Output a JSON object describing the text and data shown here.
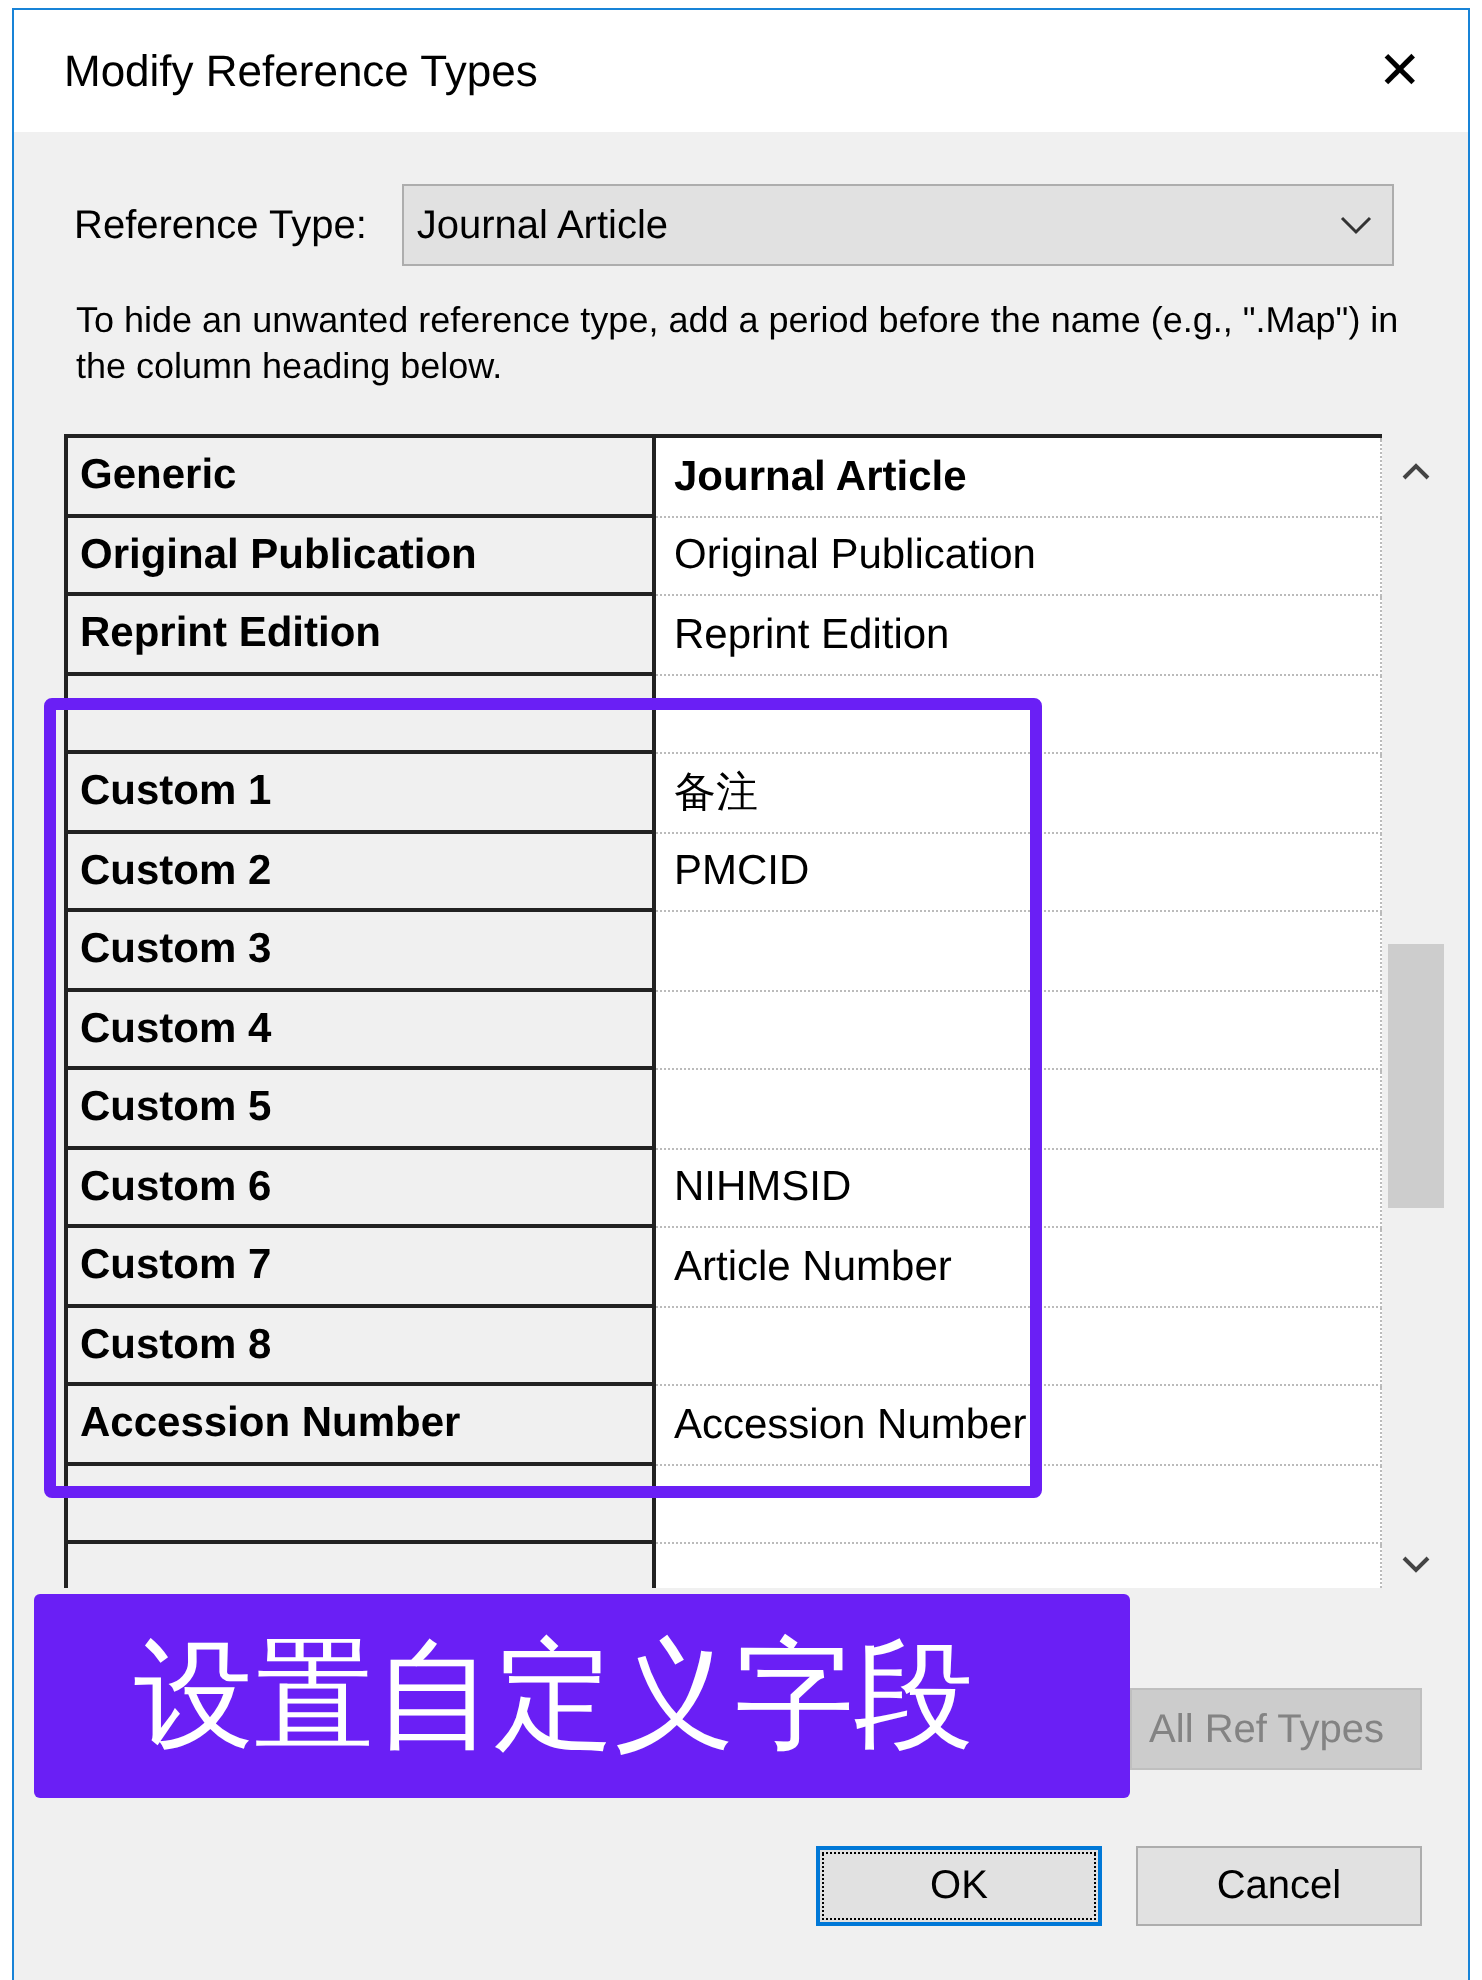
{
  "window": {
    "title": "Modify Reference Types",
    "close": "✕"
  },
  "reference_type": {
    "label": "Reference Type:",
    "value": "Journal Article"
  },
  "hint": "To hide an unwanted reference type, add a period before the name (e.g., \".Map\") in the column heading below.",
  "table": {
    "rows": [
      {
        "kind": "heading",
        "field": "Generic",
        "value": "Journal Article"
      },
      {
        "kind": "field",
        "field": "Original Publication",
        "value": "Original Publication"
      },
      {
        "kind": "field",
        "field": "Reprint Edition",
        "value": "Reprint Edition"
      },
      {
        "kind": "field"
      },
      {
        "kind": "field",
        "field": "Custom 1",
        "value": "备注"
      },
      {
        "kind": "field",
        "field": "Custom 2",
        "value": "PMCID"
      },
      {
        "kind": "field",
        "field": "Custom 3"
      },
      {
        "kind": "field",
        "field": "Custom 4"
      },
      {
        "kind": "field",
        "field": "Custom 5"
      },
      {
        "kind": "field",
        "field": "Custom 6",
        "value": "NIHMSID"
      },
      {
        "kind": "field",
        "field": "Custom 7",
        "value": "Article Number"
      },
      {
        "kind": "field",
        "field": "Custom 8"
      },
      {
        "kind": "field",
        "field": "Accession Number",
        "value": "Accession Number"
      },
      {
        "kind": "field"
      },
      {
        "kind": "field"
      }
    ]
  },
  "apply_button": "All Ref Types",
  "buttons": [
    {
      "label": "OK",
      "default": true
    },
    {
      "label": "Cancel",
      "default": false
    }
  ],
  "banner": "设置自定义字段"
}
